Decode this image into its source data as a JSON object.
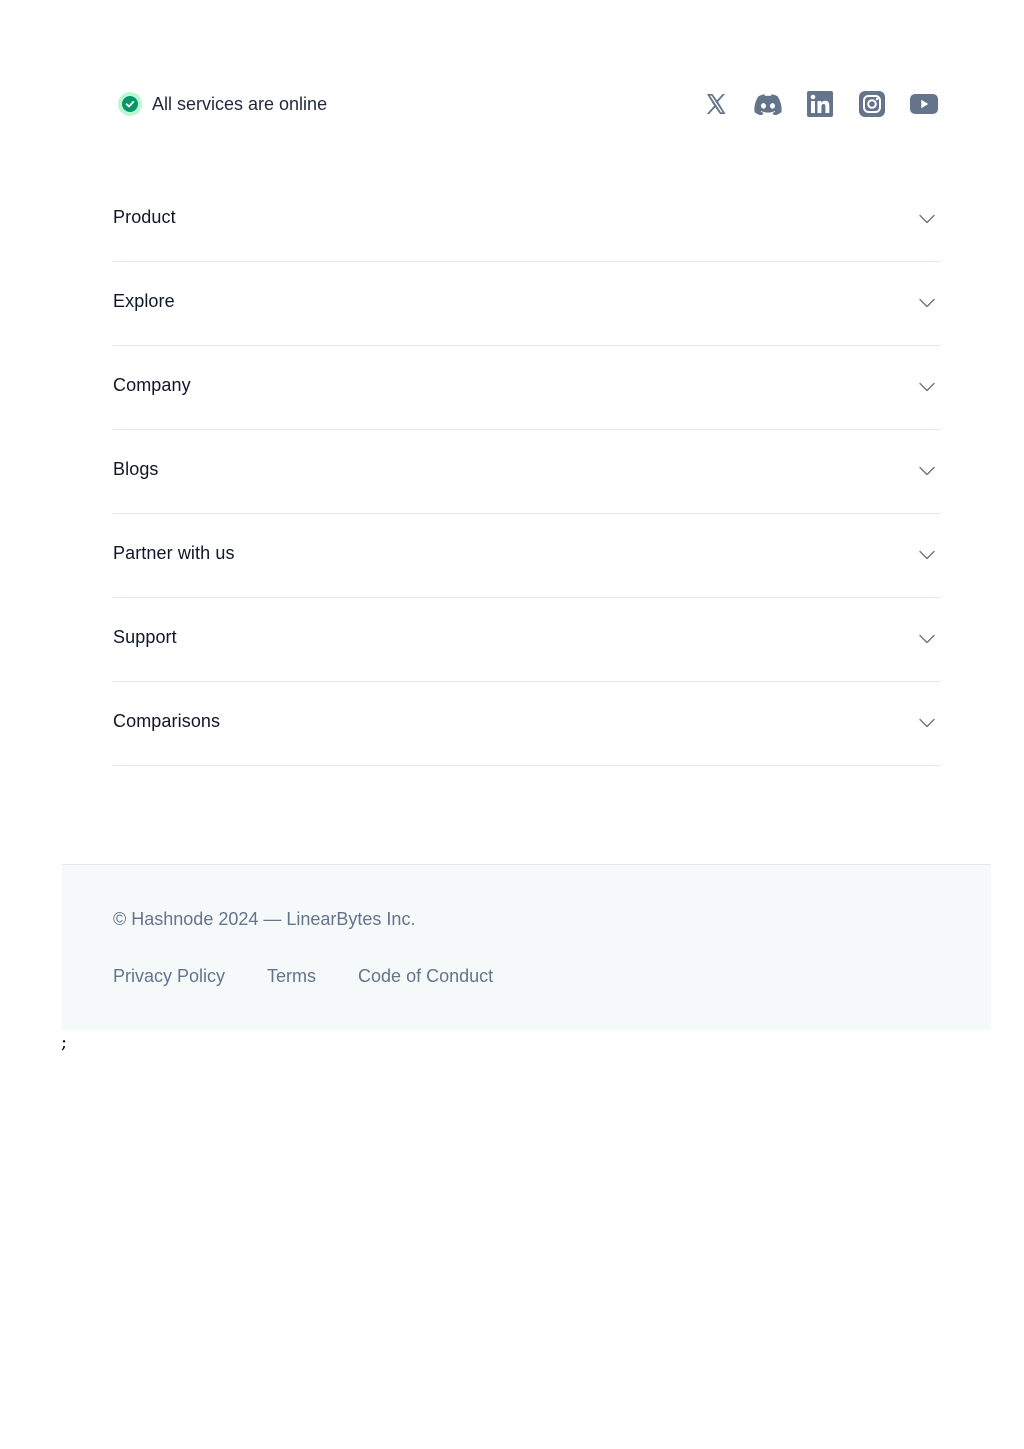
{
  "status": {
    "label": "All services are online",
    "icon": "check-circle-icon",
    "dot_color": "#059669",
    "halo_color": "#bbf7d0"
  },
  "socials": [
    {
      "name": "x-icon"
    },
    {
      "name": "discord-icon"
    },
    {
      "name": "linkedin-icon"
    },
    {
      "name": "instagram-icon"
    },
    {
      "name": "youtube-icon"
    }
  ],
  "sections": [
    {
      "label": "Product"
    },
    {
      "label": "Explore"
    },
    {
      "label": "Company"
    },
    {
      "label": "Blogs"
    },
    {
      "label": "Partner with us"
    },
    {
      "label": "Support"
    },
    {
      "label": "Comparisons"
    }
  ],
  "footer": {
    "copyright": "© Hashnode 2024 — LinearBytes Inc.",
    "links": {
      "privacy": "Privacy Policy",
      "terms": "Terms",
      "conduct": "Code of Conduct"
    }
  },
  "stray_text": ";",
  "colors": {
    "icon": "#64748b",
    "divider": "#e2e8f0",
    "footer_bg": "#f6f9fa",
    "muted_text": "#64748b"
  }
}
